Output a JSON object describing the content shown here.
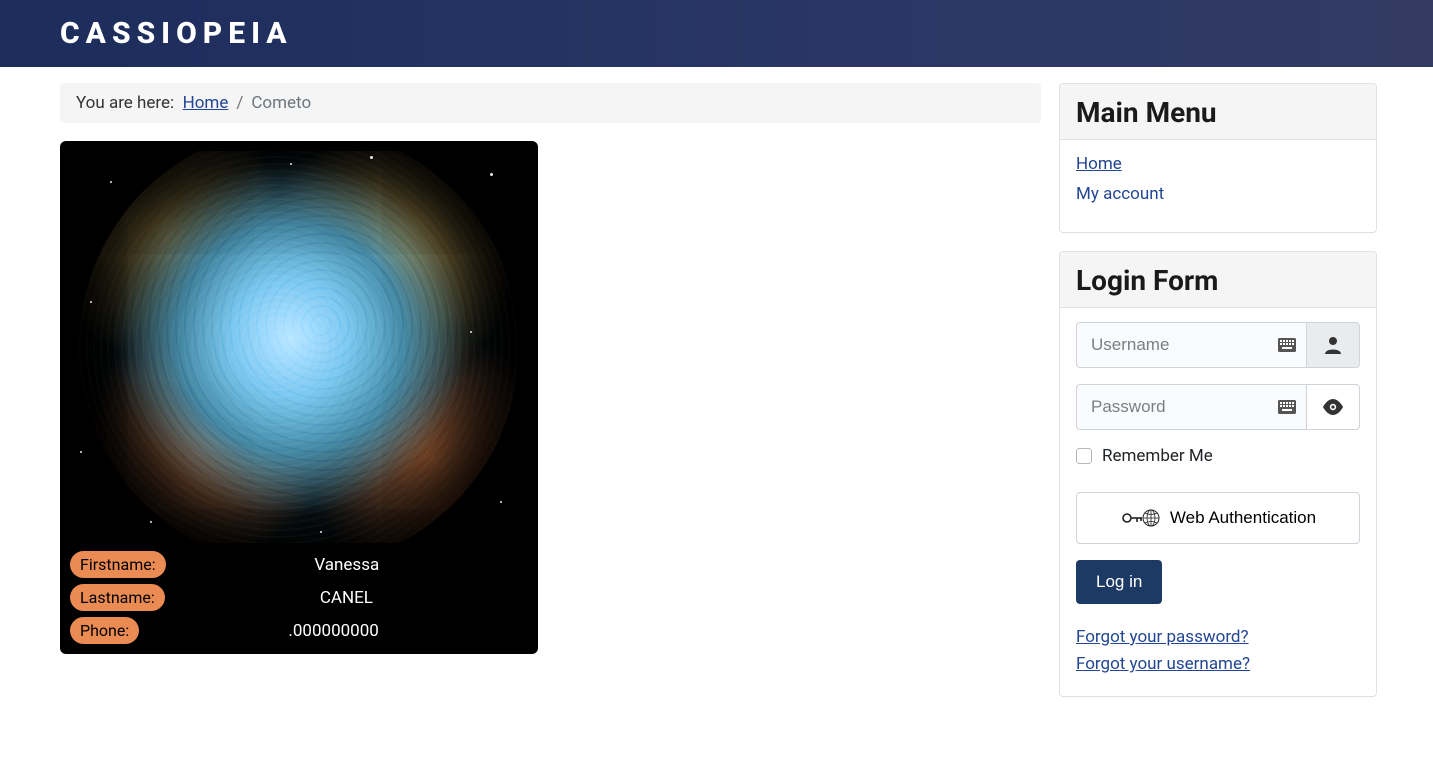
{
  "site": {
    "name": "CASSIOPEIA"
  },
  "breadcrumb": {
    "prefix": "You are here:",
    "home": "Home",
    "current": "Cometo"
  },
  "card": {
    "fields": [
      {
        "label": "Firstname:",
        "value": "Vanessa"
      },
      {
        "label": "Lastname:",
        "value": "CANEL"
      },
      {
        "label": "Phone:",
        "value": ".000000000"
      }
    ]
  },
  "sidebar": {
    "mainmenu_title": "Main Menu",
    "menu": [
      {
        "label": "Home",
        "active": true
      },
      {
        "label": "My account",
        "active": false
      }
    ],
    "login_title": "Login Form",
    "login": {
      "username_placeholder": "Username",
      "password_placeholder": "Password",
      "remember_label": "Remember Me",
      "webauthn_label": "Web Authentication",
      "submit_label": "Log in",
      "forgot_password": "Forgot your password?",
      "forgot_username": "Forgot your username?"
    }
  }
}
